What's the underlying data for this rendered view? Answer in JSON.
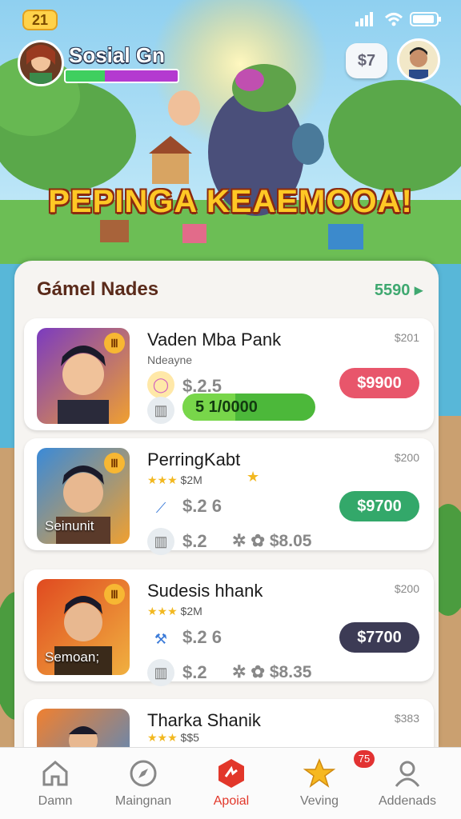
{
  "status": {
    "level": "21"
  },
  "header": {
    "player_name": "Sosial Gn",
    "xp_green": 0.35,
    "xp_purple": 0.65,
    "currency": "$7"
  },
  "banner": {
    "title": "PEPINGA KEAEMOOA!"
  },
  "panel": {
    "title": "Gámel Nades",
    "link": "5590 ▸"
  },
  "cards": [
    {
      "name": "Vaden Mba Pank",
      "sub": "Ndeayne",
      "corner": "$201",
      "price1": "$.2.5",
      "button": "$9900",
      "button_color": "#e8566b",
      "progress_text": "5     1/0000",
      "progress": 0.4
    },
    {
      "name": "PerringKabt",
      "stars": "★★★",
      "stars_text": "$2M",
      "corner": "$200",
      "price1": "$.2 6",
      "price2": "$.2",
      "gem_value": "$8.05",
      "button": "$9700",
      "button_color": "#33a86a",
      "portrait_label": "Seinunit"
    },
    {
      "name": "Sudesis hhank",
      "stars": "★★★",
      "stars_text": "$2M",
      "corner": "$200",
      "price1": "$.2 6",
      "price2": "$.2",
      "gem_value": "$8.35",
      "button": "$7700",
      "button_color": "#3c3b55",
      "portrait_label": "Semoan;"
    },
    {
      "name": "Tharka Shanik",
      "stars": "★★★",
      "stars_text": "$$5",
      "corner": "$383"
    }
  ],
  "tabs": [
    {
      "label": "Damn",
      "icon": "home-icon"
    },
    {
      "label": "Maingnan",
      "icon": "compass-icon"
    },
    {
      "label": "Apoial",
      "icon": "hexagon-icon"
    },
    {
      "label": "Veving",
      "icon": "star-icon"
    },
    {
      "label": "Addenads",
      "icon": "profile-icon"
    }
  ],
  "notification_count": "75",
  "colors": {
    "accent": "#e2372a",
    "title_gold": "#ffc825",
    "panel_bg": "#f6f4f1"
  }
}
